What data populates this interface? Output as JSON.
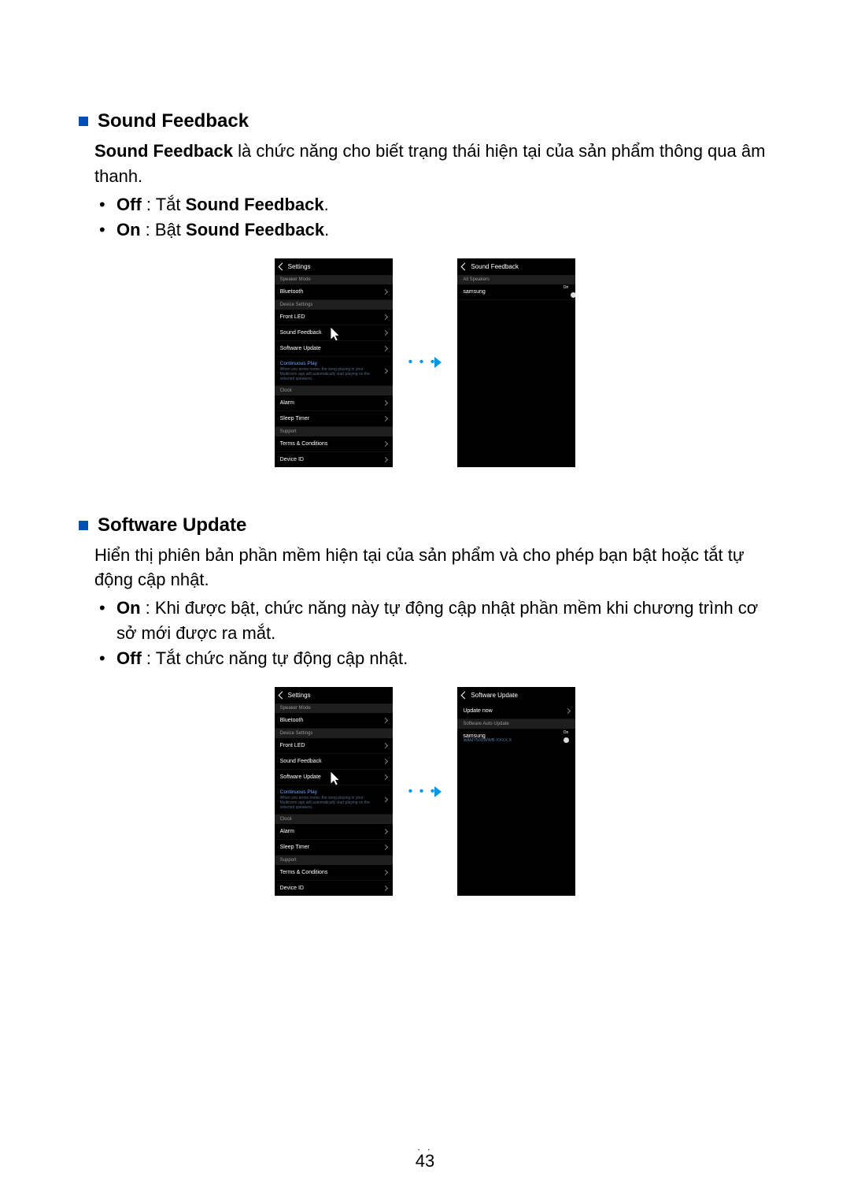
{
  "section1": {
    "title": "Sound Feedback",
    "desc_lead": "Sound Feedback",
    "desc_rest": " là chức năng cho biết trạng thái hiện tại của sản phẩm thông qua âm thanh.",
    "off_label": "Off",
    "off_text": " : Tắt ",
    "off_bold2": "Sound Feedback",
    "off_tail": ".",
    "on_label": "On",
    "on_text": " : Bật ",
    "on_bold2": "Sound Feedback",
    "on_tail": "."
  },
  "section2": {
    "title": "Software Update",
    "desc": "Hiển thị phiên bản phần mềm hiện tại của sản phẩm và cho phép bạn bật hoặc tắt tự động cập nhật.",
    "on_label": "On",
    "on_text": " : Khi được bật, chức năng này tự động cập nhật phần mềm khi chương trình cơ sở mới được ra mắt.",
    "off_label": "Off",
    "off_text": " : Tắt chức năng tự động cập nhật."
  },
  "settings_screen": {
    "title": "Settings",
    "grp_speaker": "Speaker Mode",
    "bluetooth": "Bluetooth",
    "grp_device": "Device Settings",
    "front_led": "Front LED",
    "sound_feedback": "Sound Feedback",
    "software_update": "Software Update",
    "cont_play": "Continuous Play",
    "cont_desc": "When you arrive home, the song playing in your Multiroom app will automatically start playing on the selected speakers.",
    "grp_clock": "Clock",
    "alarm": "Alarm",
    "sleep": "Sleep Timer",
    "grp_support": "Support",
    "terms": "Terms & Conditions",
    "device_id": "Device ID"
  },
  "sf_screen": {
    "title": "Sound Feedback",
    "grp": "All Speakers",
    "item": "samsung",
    "toggle": "On"
  },
  "su_screen": {
    "title": "Software Update",
    "update_now": "Update now",
    "grp_auto": "Software Auto Update",
    "item": "samsung",
    "ver": "WAM750XWWB-XXXX.X",
    "toggle": "On"
  },
  "page": "43",
  "dots": ". ."
}
